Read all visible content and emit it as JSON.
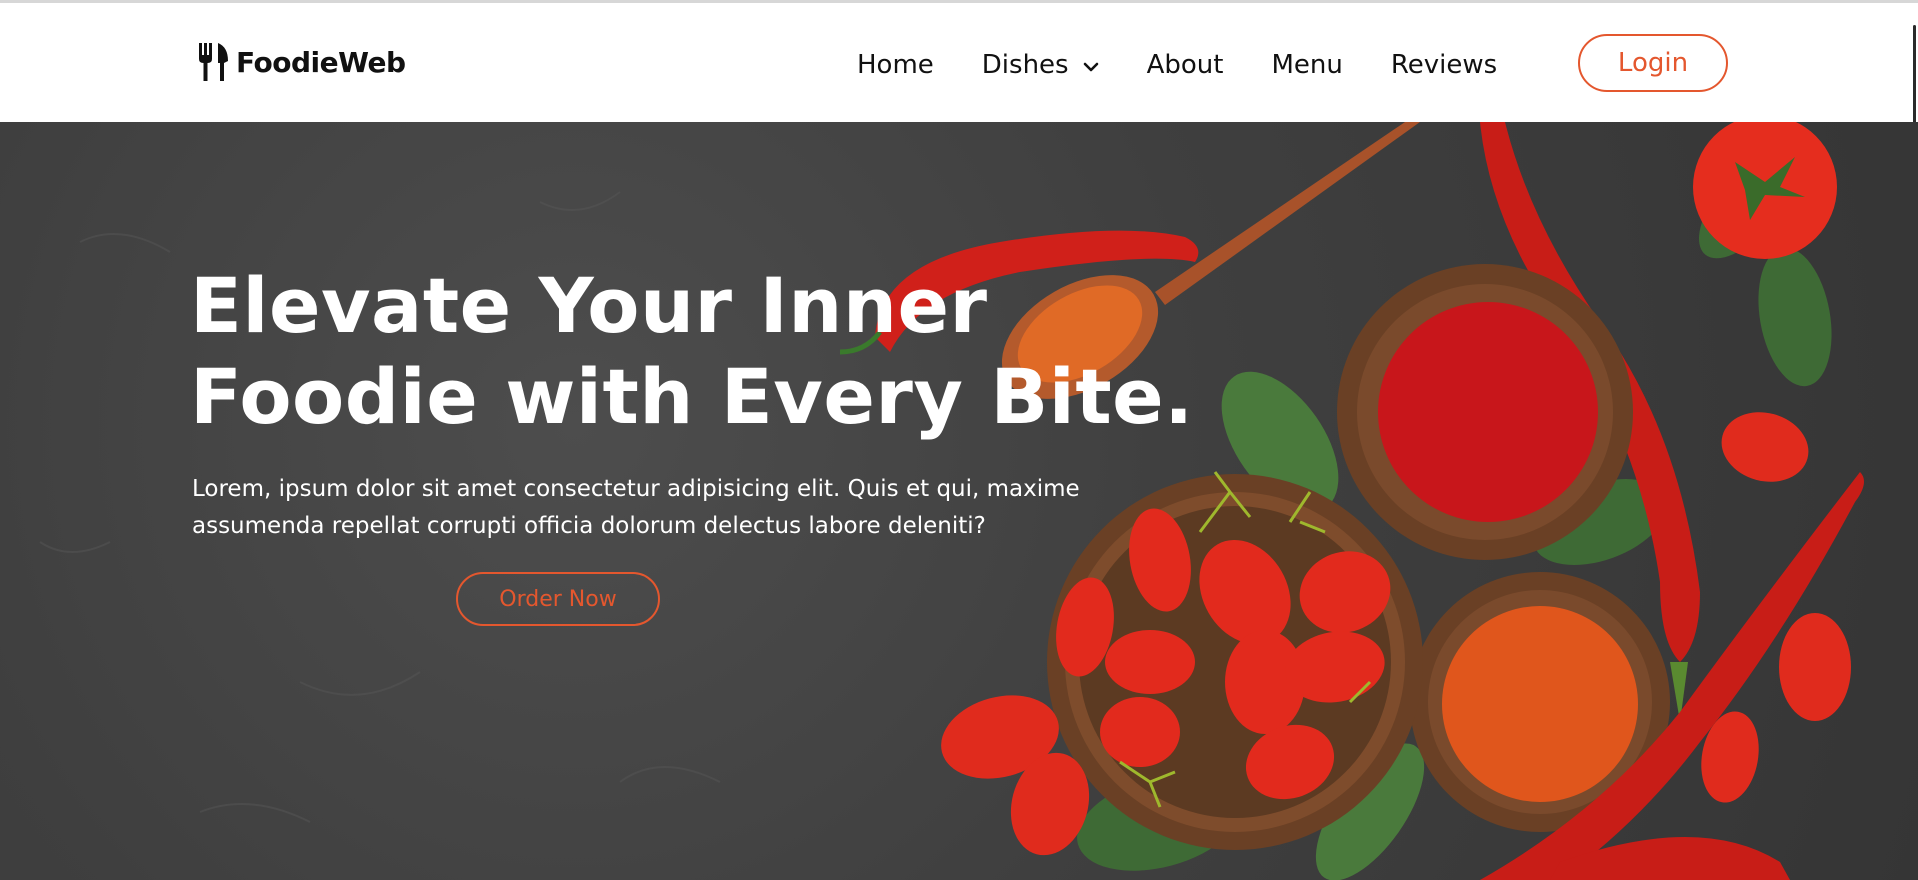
{
  "brand": {
    "name": "FoodieWeb",
    "icon": "fork-knife-icon"
  },
  "nav": {
    "items": [
      {
        "label": "Home"
      },
      {
        "label": "Dishes",
        "icon": "chevron-down-icon"
      },
      {
        "label": "About"
      },
      {
        "label": "Menu"
      },
      {
        "label": "Reviews"
      }
    ],
    "login_label": "Login"
  },
  "hero": {
    "title_line1": "Elevate Your Inner",
    "title_line2": "Foodie with Every Bite.",
    "text": "Lorem, ipsum dolor sit amet consectetur adipisicing elit. Quis et qui, maxime assumenda repellat corrupti officia dolorum delectus labore deleniti?",
    "cta_label": "Order Now"
  },
  "colors": {
    "accent": "#e4572e",
    "hero_bg": "#3f3f3f",
    "text_dark": "#111111"
  }
}
